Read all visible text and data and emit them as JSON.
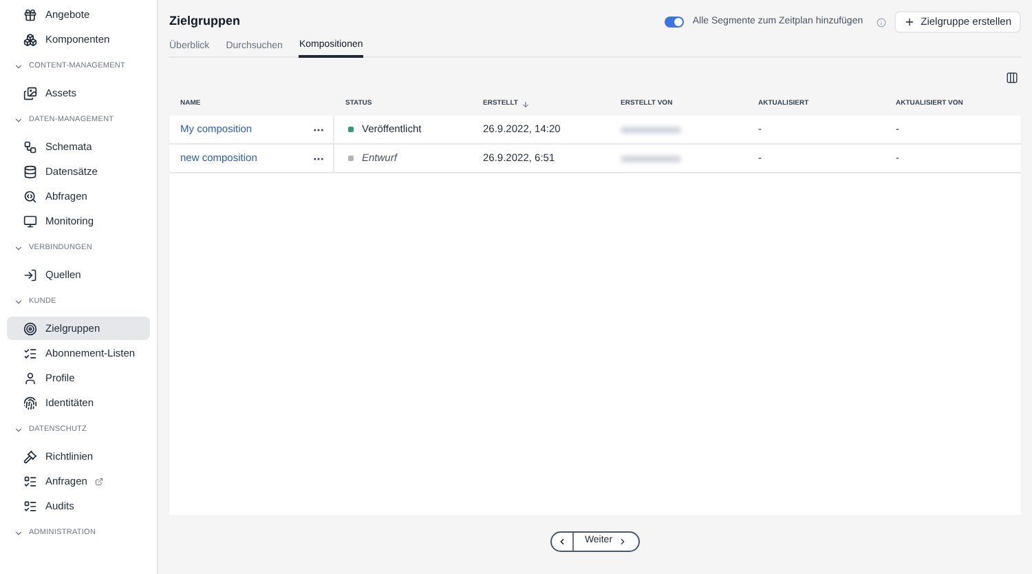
{
  "sidebar": {
    "items": [
      {
        "kind": "item",
        "label": "Angebote",
        "selected": false,
        "external": false
      },
      {
        "kind": "item",
        "label": "Komponenten",
        "selected": false,
        "external": false
      },
      {
        "kind": "section",
        "label": "CONTENT-MANAGEMENT",
        "expanded": true
      },
      {
        "kind": "item",
        "label": "Assets",
        "selected": false,
        "external": false
      },
      {
        "kind": "section",
        "label": "DATEN-MANAGEMENT",
        "expanded": true
      },
      {
        "kind": "item",
        "label": "Schemata",
        "selected": false,
        "external": false
      },
      {
        "kind": "item",
        "label": "Datensätze",
        "selected": false,
        "external": false
      },
      {
        "kind": "item",
        "label": "Abfragen",
        "selected": false,
        "external": false
      },
      {
        "kind": "item",
        "label": "Monitoring",
        "selected": false,
        "external": false
      },
      {
        "kind": "section",
        "label": "VERBINDUNGEN",
        "expanded": true
      },
      {
        "kind": "item",
        "label": "Quellen",
        "selected": false,
        "external": false
      },
      {
        "kind": "section",
        "label": "KUNDE",
        "expanded": true
      },
      {
        "kind": "item",
        "label": "Zielgruppen",
        "selected": true,
        "external": false
      },
      {
        "kind": "item",
        "label": "Abonnement-Listen",
        "selected": false,
        "external": false
      },
      {
        "kind": "item",
        "label": "Profile",
        "selected": false,
        "external": false
      },
      {
        "kind": "item",
        "label": "Identitäten",
        "selected": false,
        "external": false
      },
      {
        "kind": "section",
        "label": "DATENSCHUTZ",
        "expanded": true
      },
      {
        "kind": "item",
        "label": "Richtlinien",
        "selected": false,
        "external": false
      },
      {
        "kind": "item",
        "label": "Anfragen",
        "selected": false,
        "external": true
      },
      {
        "kind": "item",
        "label": "Audits",
        "selected": false,
        "external": false
      },
      {
        "kind": "section",
        "label": "ADMINISTRATION",
        "expanded": true
      }
    ]
  },
  "header": {
    "title": "Zielgruppen",
    "toggle": {
      "label": "Alle Segmente zum Zeitplan hinzufügen",
      "on": true
    },
    "create_button": "Zielgruppe erstellen"
  },
  "tabs": [
    {
      "label": "Überblick",
      "selected": false
    },
    {
      "label": "Durchsuchen",
      "selected": false
    },
    {
      "label": "Kompositionen",
      "selected": true
    }
  ],
  "table": {
    "columns": [
      {
        "label": "NAME",
        "sorted": false
      },
      {
        "label": "STATUS",
        "sorted": false
      },
      {
        "label": "ERSTELLT",
        "sorted": true
      },
      {
        "label": "ERSTELLT VON",
        "sorted": false
      },
      {
        "label": "AKTUALISIERT",
        "sorted": false
      },
      {
        "label": "AKTUALISIERT VON",
        "sorted": false
      }
    ],
    "rows": [
      {
        "name": "My composition",
        "status": {
          "kind": "published",
          "label": "Veröffentlicht",
          "color": "#2d9d78"
        },
        "created": "26.9.2022, 14:20",
        "updated": "-",
        "updated_by": "-"
      },
      {
        "name": "new composition",
        "status": {
          "kind": "draft",
          "label": "Entwurf",
          "color": "#b3b3b3"
        },
        "created": "26.9.2022, 6:51",
        "updated": "-",
        "updated_by": "-"
      }
    ]
  },
  "pagination": {
    "next": "Weiter"
  }
}
